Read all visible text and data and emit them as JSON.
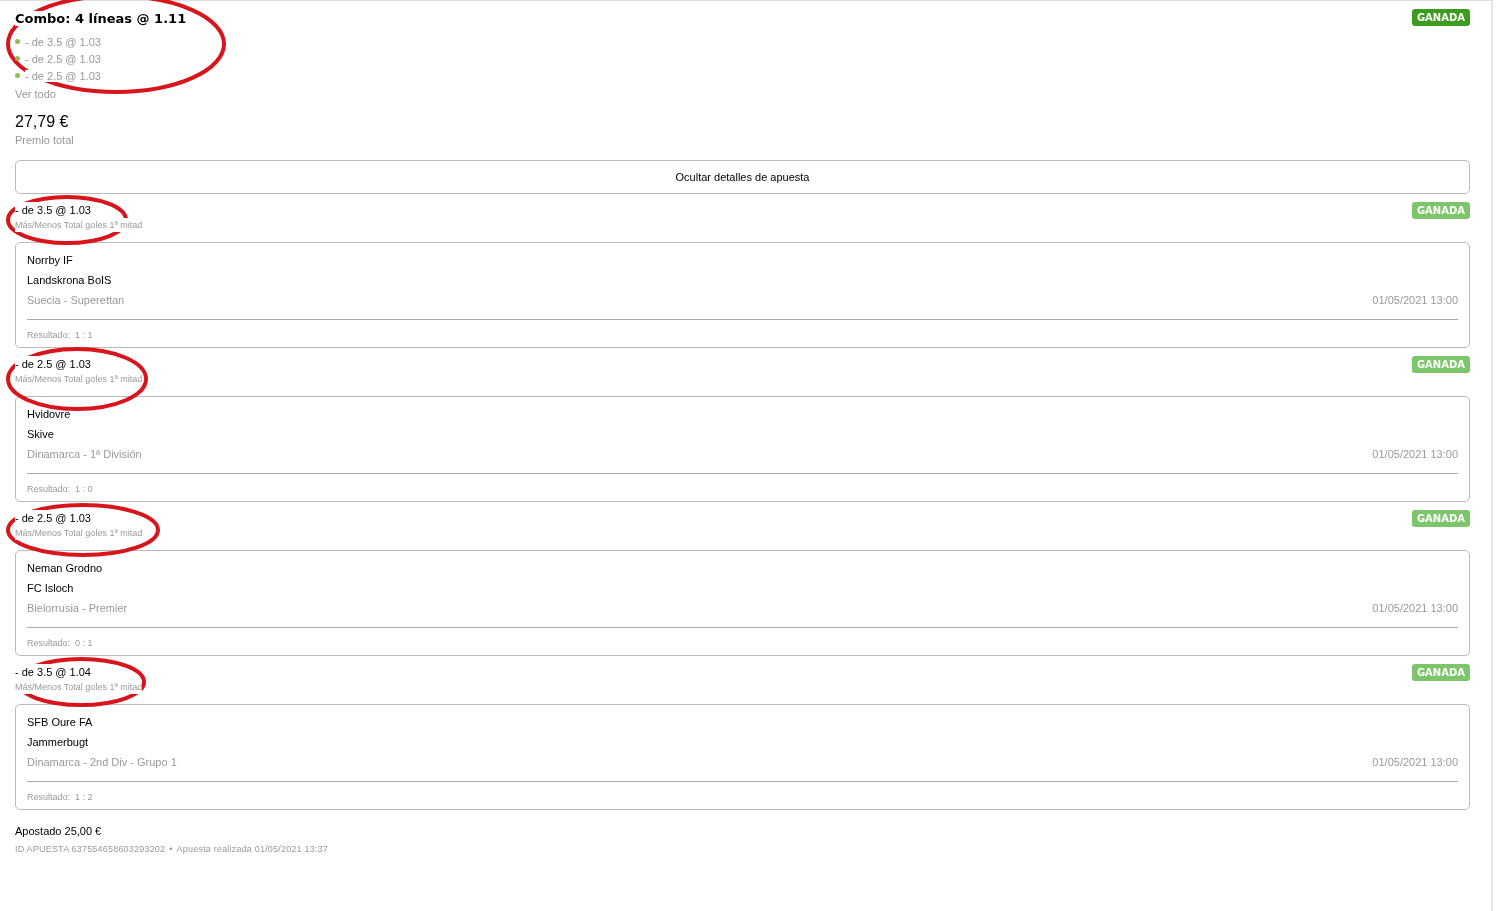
{
  "bet": {
    "title": "Combo: 4 líneas @ 1.11",
    "status": "GANADA",
    "circled": true,
    "summary": [
      {
        "text": "- de 3.5 @ 1.03",
        "color": "#8bc34a"
      },
      {
        "text": "- de 2.5 @ 1.03",
        "color": "#8bc34a"
      },
      {
        "text": "- de 2.5 @ 1.03",
        "color": "#8bc34a"
      }
    ],
    "see_all": "Ver todo",
    "amount": "27,79 €",
    "amount_label": "Premio total",
    "toggle_button": "Ocultar detalles de apuesta",
    "legs": [
      {
        "selection": "- de 3.5 @ 1.03",
        "market": "Más/Menos Total goles 1ª mitad",
        "status": "GANADA",
        "circled": true,
        "home": "Norrby IF",
        "away": "Landskrona BoIS",
        "league": "Suecia - Superettan",
        "date": "01/05/2021 13:00",
        "result_label": "Resultado:",
        "result": "1 : 1"
      },
      {
        "selection": "- de 2.5 @ 1.03",
        "market": "Más/Menos Total goles 1ª mitad",
        "status": "GANADA",
        "circled": true,
        "home": "Hvidovre",
        "away": "Skive",
        "league": "Dinamarca - 1ª División",
        "date": "01/05/2021 13:00",
        "result_label": "Resultado:",
        "result": "1 : 0"
      },
      {
        "selection": "- de 2.5 @ 1.03",
        "market": "Más/Menos Total goles 1ª mitad",
        "status": "GANADA",
        "circled": true,
        "home": "Neman Grodno",
        "away": "FC Isloch",
        "league": "Bielorrusia - Premier",
        "date": "01/05/2021 13:00",
        "result_label": "Resultado:",
        "result": "0 : 1"
      },
      {
        "selection": "- de 3.5 @ 1.04",
        "market": "Más/Menos Total goles 1ª mitad",
        "status": "GANADA",
        "circled": true,
        "home": "SFB Oure FA",
        "away": "Jammerbugt",
        "league": "Dinamarca - 2nd Div - Grupo 1",
        "date": "01/05/2021 13:00",
        "result_label": "Resultado:",
        "result": "1 : 2"
      }
    ],
    "staked": "Apostado 25,00 €",
    "bet_id": "ID APUESTA 637554658603293202",
    "separator": "•",
    "placed": "Apuesta realizada 01/05/2021 13:37"
  }
}
